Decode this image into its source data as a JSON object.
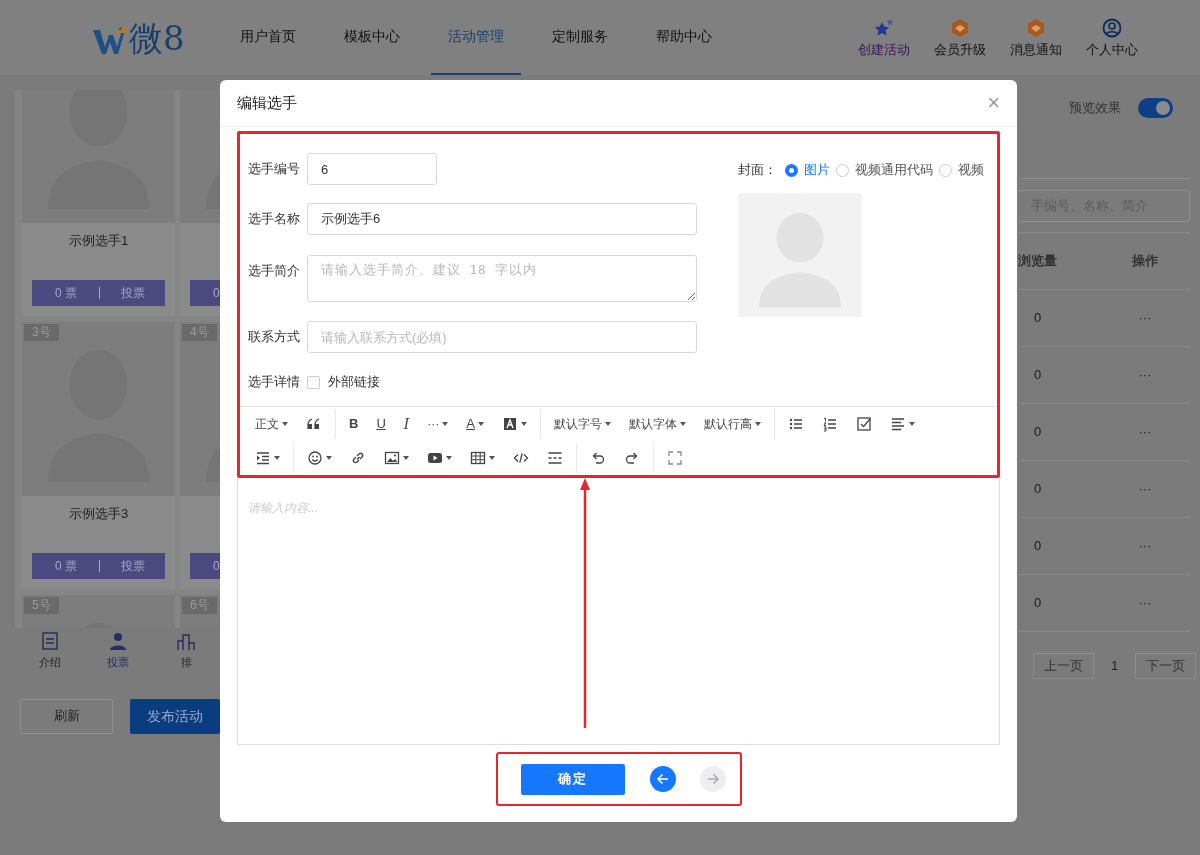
{
  "header": {
    "logo": "微8",
    "nav": [
      {
        "label": "用户首页",
        "selected": false
      },
      {
        "label": "模板中心",
        "selected": false
      },
      {
        "label": "活动管理",
        "selected": true
      },
      {
        "label": "定制服务",
        "selected": false
      },
      {
        "label": "帮助中心",
        "selected": false
      }
    ],
    "actions": [
      {
        "label": "创建活动",
        "kind": "create"
      },
      {
        "label": "会员升级",
        "kind": "upgrade"
      },
      {
        "label": "消息通知",
        "kind": "notice"
      },
      {
        "label": "个人中心",
        "kind": "profile"
      }
    ]
  },
  "contestant_cards": [
    {
      "name": "示例选手1",
      "votes": "0 票",
      "vote_button": "投票"
    },
    {
      "votes": "0"
    },
    {
      "badge": "3号",
      "name": "示例选手3",
      "votes": "0 票",
      "vote_button": "投票"
    },
    {
      "badge": "4号",
      "votes": "0"
    },
    {
      "badge": "5号"
    },
    {
      "badge": "6号"
    }
  ],
  "bottom_tabs": [
    {
      "label": "介绍",
      "kind": "intro",
      "selected": false
    },
    {
      "label": "投票",
      "kind": "vote",
      "selected": true
    },
    {
      "label": "排",
      "kind": "rank",
      "selected": false
    }
  ],
  "page_buttons": {
    "refresh": "刷新",
    "publish": "发布活动"
  },
  "preview": {
    "label": "预览效果",
    "on": true
  },
  "search": {
    "placeholder": "手编号、名称、简介"
  },
  "table": {
    "columns": [
      "浏览量",
      "操作"
    ],
    "rows": [
      {
        "views": "0",
        "action": "···"
      },
      {
        "views": "0",
        "action": "···"
      },
      {
        "views": "0",
        "action": "···"
      },
      {
        "views": "0",
        "action": "···"
      },
      {
        "views": "0",
        "action": "···"
      },
      {
        "views": "0",
        "action": "···"
      }
    ]
  },
  "pagination": {
    "prev": "上一页",
    "page": "1",
    "next": "下一页"
  },
  "modal": {
    "title": "编辑选手",
    "close": "×",
    "fields": [
      {
        "label": "选手编号",
        "kind": "short",
        "value": "6"
      },
      {
        "label": "选手名称",
        "kind": "input",
        "value": "示例选手6"
      },
      {
        "label": "选手简介",
        "kind": "textarea",
        "placeholder": "请输入选手简介、建议 18 字以内"
      },
      {
        "label": "联系方式",
        "kind": "input",
        "placeholder": "请输入联系方式(必填)"
      }
    ],
    "details": {
      "label": "选手详情",
      "checkbox_label": "外部链接",
      "checked": false
    },
    "cover": {
      "label": "封面：",
      "options": [
        {
          "label": "图片",
          "selected": true
        },
        {
          "label": "视频通用代码",
          "selected": false
        },
        {
          "label": "视频",
          "selected": false
        }
      ]
    },
    "toolbar": [
      [
        [
          {
            "kind": "text",
            "label": "正文",
            "dropdown": true
          },
          {
            "kind": "quote"
          }
        ],
        [
          {
            "kind": "bold",
            "label": "B"
          },
          {
            "kind": "underline",
            "label": "U"
          },
          {
            "kind": "italic",
            "label": "I"
          },
          {
            "kind": "text",
            "label": "···",
            "dropdown": true
          },
          {
            "kind": "fontcolor",
            "label": "A",
            "dropdown": true
          },
          {
            "kind": "bgcolor",
            "dropdown": true
          }
        ],
        [
          {
            "kind": "text",
            "label": "默认字号",
            "dropdown": true
          },
          {
            "kind": "text",
            "label": "默认字体",
            "dropdown": true
          },
          {
            "kind": "text",
            "label": "默认行高",
            "dropdown": true
          }
        ],
        [
          {
            "kind": "ul"
          },
          {
            "kind": "ol"
          },
          {
            "kind": "todo"
          },
          {
            "kind": "align",
            "dropdown": true
          }
        ]
      ],
      [
        [
          {
            "kind": "indent",
            "dropdown": true
          }
        ],
        [
          {
            "kind": "emoji",
            "dropdown": true
          },
          {
            "kind": "link"
          },
          {
            "kind": "image",
            "dropdown": true
          },
          {
            "kind": "video",
            "dropdown": true
          },
          {
            "kind": "table",
            "dropdown": true
          },
          {
            "kind": "code"
          },
          {
            "kind": "hr"
          }
        ],
        [
          {
            "kind": "undo"
          },
          {
            "kind": "redo"
          }
        ],
        [
          {
            "kind": "fullscreen"
          }
        ]
      ]
    ],
    "editor_placeholder": "请输入内容...",
    "confirm": "确定",
    "back": {
      "disabled": false
    },
    "forward": {
      "disabled": true
    }
  }
}
